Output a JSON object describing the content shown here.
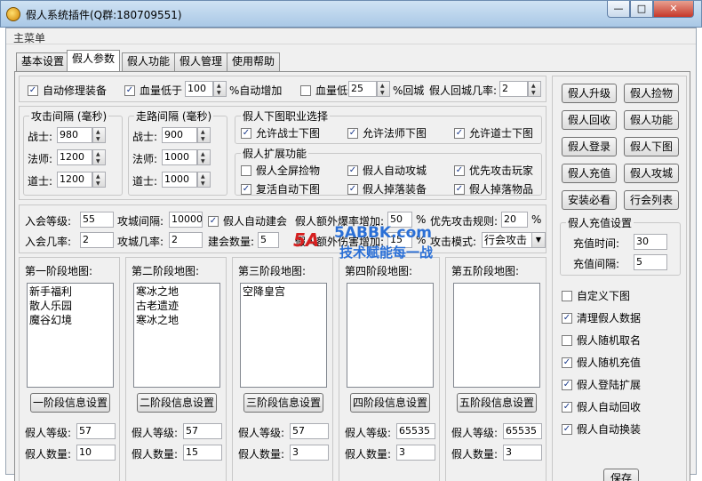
{
  "window": {
    "title": "假人系统插件(Q群:180709551)",
    "min": "—",
    "max": "□",
    "close": "✕"
  },
  "menu": {
    "main": "主菜单"
  },
  "tabs": [
    "基本设置",
    "假人参数",
    "假人功能",
    "假人管理",
    "使用帮助"
  ],
  "top": {
    "auto_repair": "自动修理装备",
    "hp_low_label": "血量低于",
    "hp_low_value": "100",
    "auto_add": "%自动增加",
    "hp_low2_label": "血量低于",
    "hp_low2_value": "25",
    "return_city": "%回城",
    "return_rate_label": "假人回城几率:",
    "return_rate_value": "2"
  },
  "attack_interval": {
    "title": "攻击间隔 (毫秒)",
    "warrior_label": "战士:",
    "warrior_value": "980",
    "mage_label": "法师:",
    "mage_value": "1200",
    "taoist_label": "道士:",
    "taoist_value": "1200"
  },
  "walk_interval": {
    "title": "走路间隔 (毫秒)",
    "warrior_label": "战士:",
    "warrior_value": "900",
    "mage_label": "法师:",
    "mage_value": "1000",
    "taoist_label": "道士:",
    "taoist_value": "1000"
  },
  "job_select": {
    "title": "假人下图职业选择",
    "warrior": "允许战士下图",
    "mage": "允许法师下图",
    "taoist": "允许道士下图"
  },
  "extend": {
    "title": "假人扩展功能",
    "fullscreen_pick": "假人全屏捡物",
    "auto_siege": "假人自动攻城",
    "attack_player_first": "优先攻击玩家",
    "revive_auto": "复活自动下图",
    "drop_equip": "假人掉落装备",
    "drop_items": "假人掉落物品"
  },
  "guild": {
    "join_level_label": "入会等级:",
    "join_level_value": "55",
    "siege_interval_label": "攻城间隔:",
    "siege_interval_value": "10000",
    "auto_build": "假人自动建会",
    "extra_burst_label": "假人额外爆率增加:",
    "extra_burst_value": "50",
    "percent": "%",
    "priority_label": "优先攻击规则:",
    "priority_value": "20",
    "join_rate_label": "入会几率:",
    "join_rate_value": "2",
    "siege_rate_label": "攻城几率:",
    "siege_rate_value": "2",
    "build_count_label": "建会数量:",
    "build_count_value": "5",
    "extra_damage_label": "假人额外伤害增加:",
    "extra_damage_value": "15",
    "attack_mode_label": "攻击模式:",
    "attack_mode_value": "行会攻击"
  },
  "stages": [
    {
      "title": "第一阶段地图:",
      "maps": [
        "新手福利",
        "散人乐园",
        "魔谷幻境"
      ],
      "button": "一阶段信息设置",
      "level_label": "假人等级:",
      "level": "57",
      "count_label": "假人数量:",
      "count": "10"
    },
    {
      "title": "第二阶段地图:",
      "maps": [
        "寒冰之地",
        "古老遗迹",
        "寒冰之地"
      ],
      "button": "二阶段信息设置",
      "level_label": "假人等级:",
      "level": "57",
      "count_label": "假人数量:",
      "count": "15"
    },
    {
      "title": "第三阶段地图:",
      "maps": [
        "空降皇宫"
      ],
      "button": "三阶段信息设置",
      "level_label": "假人等级:",
      "level": "57",
      "count_label": "假人数量:",
      "count": "3"
    },
    {
      "title": "第四阶段地图:",
      "maps": [],
      "button": "四阶段信息设置",
      "level_label": "假人等级:",
      "level": "65535",
      "count_label": "假人数量:",
      "count": "3"
    },
    {
      "title": "第五阶段地图:",
      "maps": [],
      "button": "五阶段信息设置",
      "level_label": "假人等级:",
      "level": "65535",
      "count_label": "假人数量:",
      "count": "3"
    }
  ],
  "side_buttons": [
    "假人升级",
    "假人捡物",
    "假人回收",
    "假人功能",
    "假人登录",
    "假人下图",
    "假人充值",
    "假人攻城",
    "安装必看",
    "行会列表"
  ],
  "recharge": {
    "title": "假人充值设置",
    "time_label": "充值时间:",
    "time_value": "30",
    "interval_label": "充值间隔:",
    "interval_value": "5"
  },
  "side_checks": [
    {
      "label": "自定义下图",
      "checked": false
    },
    {
      "label": "清理假人数据",
      "checked": true
    },
    {
      "label": "假人随机取名",
      "checked": false
    },
    {
      "label": "假人随机充值",
      "checked": true
    },
    {
      "label": "假人登陆扩展",
      "checked": true
    },
    {
      "label": "假人自动回收",
      "checked": true
    },
    {
      "label": "假人自动换装",
      "checked": true
    }
  ],
  "save": "保存",
  "watermark": {
    "logo": "5A",
    "site": "5ABBK.com",
    "slogan": "技术赋能每一战"
  }
}
